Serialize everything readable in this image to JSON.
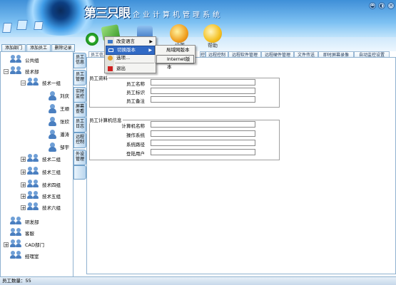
{
  "header": {
    "brand": "第三只眼",
    "subtitle": "企业计算机管理系统",
    "window_buttons": [
      "◒",
      "◐",
      "✕"
    ]
  },
  "toolbar": {
    "items": [
      {
        "label": "",
        "icon": "refresh-icon"
      },
      {
        "label": "文",
        "icon": "book-icon"
      },
      {
        "label": "",
        "icon": "disk-icon"
      },
      {
        "label": "设置",
        "icon": "tools-icon"
      },
      {
        "label": "帮助",
        "icon": "help-icon"
      }
    ]
  },
  "left_tabs": [
    "添加部门",
    "添加员工",
    "删除记录"
  ],
  "tree": {
    "public": "公共组",
    "tech": "技术部",
    "tech1": "技术一组",
    "members": [
      "刘庆",
      "王顺",
      "张欣",
      "潘涛",
      "邹宇"
    ],
    "groups": [
      "技术二组",
      "技术三组",
      "技术四组",
      "技术五组",
      "技术六组"
    ],
    "depts": [
      "研发部",
      "客服",
      "CAD部门",
      "经理室"
    ]
  },
  "vertical_tabs": [
    "员工信息",
    "员工管理",
    "实时监控",
    "屏幕查看",
    "员工日志",
    "远程控制",
    "外设管理"
  ],
  "top_tabs": {
    "first": "员工信息",
    "rest": [
      "控",
      "远程控制",
      "远程软件管理",
      "远程硬件管理",
      "文件传送",
      "即时屏幕录像",
      "自动监控设置"
    ]
  },
  "employee_section": {
    "legend": "员工资料",
    "fields": [
      "员工名称",
      "员工标识",
      "员工备注"
    ]
  },
  "computer_section": {
    "legend": "员工计算机信息",
    "fields": [
      "计算机名称",
      "操作系统",
      "系统路径",
      "登陆用户"
    ]
  },
  "menu": {
    "items": [
      "改变语言",
      "切换版本",
      "选项...",
      "退出"
    ],
    "submenu": [
      "局域网版本",
      "Internet版本"
    ]
  },
  "status": {
    "text": "员工数量：55"
  },
  "colors": {
    "header_top": "#3f8fd8",
    "accent": "#4a7fc0",
    "highlight": "#316ac5"
  }
}
